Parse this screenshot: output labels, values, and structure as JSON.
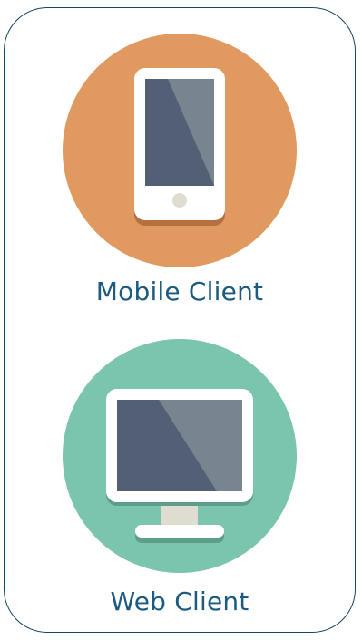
{
  "clients": [
    {
      "label": "Mobile Client",
      "icon": "smartphone-icon",
      "circle_color": "#e0995f"
    },
    {
      "label": "Web Client",
      "icon": "desktop-monitor-icon",
      "circle_color": "#7bc4ad"
    }
  ],
  "colors": {
    "border": "#13455f",
    "label_text": "#1b5b7f",
    "screen_dark": "#535f74",
    "screen_light": "#78848f",
    "device_frame": "#ffffff"
  }
}
